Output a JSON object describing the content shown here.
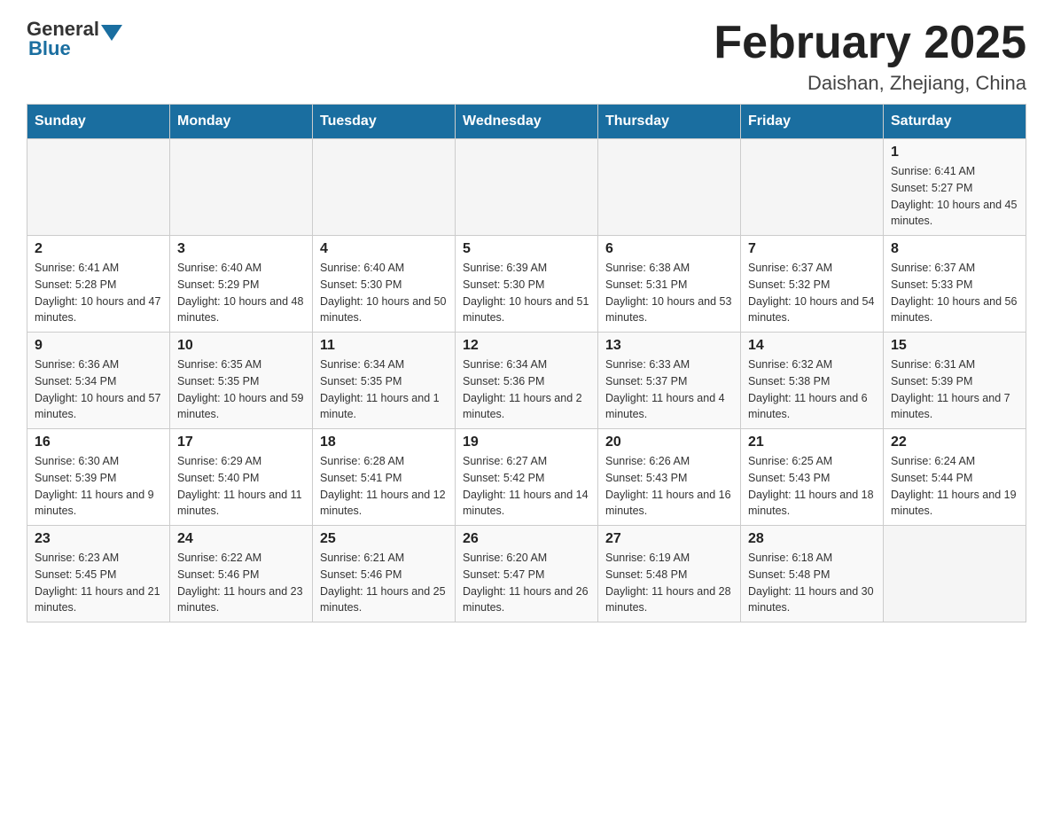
{
  "header": {
    "logo_general": "General",
    "logo_blue": "Blue",
    "month_title": "February 2025",
    "location": "Daishan, Zhejiang, China"
  },
  "weekdays": [
    "Sunday",
    "Monday",
    "Tuesday",
    "Wednesday",
    "Thursday",
    "Friday",
    "Saturday"
  ],
  "weeks": [
    [
      {
        "day": "",
        "sunrise": "",
        "sunset": "",
        "daylight": ""
      },
      {
        "day": "",
        "sunrise": "",
        "sunset": "",
        "daylight": ""
      },
      {
        "day": "",
        "sunrise": "",
        "sunset": "",
        "daylight": ""
      },
      {
        "day": "",
        "sunrise": "",
        "sunset": "",
        "daylight": ""
      },
      {
        "day": "",
        "sunrise": "",
        "sunset": "",
        "daylight": ""
      },
      {
        "day": "",
        "sunrise": "",
        "sunset": "",
        "daylight": ""
      },
      {
        "day": "1",
        "sunrise": "Sunrise: 6:41 AM",
        "sunset": "Sunset: 5:27 PM",
        "daylight": "Daylight: 10 hours and 45 minutes."
      }
    ],
    [
      {
        "day": "2",
        "sunrise": "Sunrise: 6:41 AM",
        "sunset": "Sunset: 5:28 PM",
        "daylight": "Daylight: 10 hours and 47 minutes."
      },
      {
        "day": "3",
        "sunrise": "Sunrise: 6:40 AM",
        "sunset": "Sunset: 5:29 PM",
        "daylight": "Daylight: 10 hours and 48 minutes."
      },
      {
        "day": "4",
        "sunrise": "Sunrise: 6:40 AM",
        "sunset": "Sunset: 5:30 PM",
        "daylight": "Daylight: 10 hours and 50 minutes."
      },
      {
        "day": "5",
        "sunrise": "Sunrise: 6:39 AM",
        "sunset": "Sunset: 5:30 PM",
        "daylight": "Daylight: 10 hours and 51 minutes."
      },
      {
        "day": "6",
        "sunrise": "Sunrise: 6:38 AM",
        "sunset": "Sunset: 5:31 PM",
        "daylight": "Daylight: 10 hours and 53 minutes."
      },
      {
        "day": "7",
        "sunrise": "Sunrise: 6:37 AM",
        "sunset": "Sunset: 5:32 PM",
        "daylight": "Daylight: 10 hours and 54 minutes."
      },
      {
        "day": "8",
        "sunrise": "Sunrise: 6:37 AM",
        "sunset": "Sunset: 5:33 PM",
        "daylight": "Daylight: 10 hours and 56 minutes."
      }
    ],
    [
      {
        "day": "9",
        "sunrise": "Sunrise: 6:36 AM",
        "sunset": "Sunset: 5:34 PM",
        "daylight": "Daylight: 10 hours and 57 minutes."
      },
      {
        "day": "10",
        "sunrise": "Sunrise: 6:35 AM",
        "sunset": "Sunset: 5:35 PM",
        "daylight": "Daylight: 10 hours and 59 minutes."
      },
      {
        "day": "11",
        "sunrise": "Sunrise: 6:34 AM",
        "sunset": "Sunset: 5:35 PM",
        "daylight": "Daylight: 11 hours and 1 minute."
      },
      {
        "day": "12",
        "sunrise": "Sunrise: 6:34 AM",
        "sunset": "Sunset: 5:36 PM",
        "daylight": "Daylight: 11 hours and 2 minutes."
      },
      {
        "day": "13",
        "sunrise": "Sunrise: 6:33 AM",
        "sunset": "Sunset: 5:37 PM",
        "daylight": "Daylight: 11 hours and 4 minutes."
      },
      {
        "day": "14",
        "sunrise": "Sunrise: 6:32 AM",
        "sunset": "Sunset: 5:38 PM",
        "daylight": "Daylight: 11 hours and 6 minutes."
      },
      {
        "day": "15",
        "sunrise": "Sunrise: 6:31 AM",
        "sunset": "Sunset: 5:39 PM",
        "daylight": "Daylight: 11 hours and 7 minutes."
      }
    ],
    [
      {
        "day": "16",
        "sunrise": "Sunrise: 6:30 AM",
        "sunset": "Sunset: 5:39 PM",
        "daylight": "Daylight: 11 hours and 9 minutes."
      },
      {
        "day": "17",
        "sunrise": "Sunrise: 6:29 AM",
        "sunset": "Sunset: 5:40 PM",
        "daylight": "Daylight: 11 hours and 11 minutes."
      },
      {
        "day": "18",
        "sunrise": "Sunrise: 6:28 AM",
        "sunset": "Sunset: 5:41 PM",
        "daylight": "Daylight: 11 hours and 12 minutes."
      },
      {
        "day": "19",
        "sunrise": "Sunrise: 6:27 AM",
        "sunset": "Sunset: 5:42 PM",
        "daylight": "Daylight: 11 hours and 14 minutes."
      },
      {
        "day": "20",
        "sunrise": "Sunrise: 6:26 AM",
        "sunset": "Sunset: 5:43 PM",
        "daylight": "Daylight: 11 hours and 16 minutes."
      },
      {
        "day": "21",
        "sunrise": "Sunrise: 6:25 AM",
        "sunset": "Sunset: 5:43 PM",
        "daylight": "Daylight: 11 hours and 18 minutes."
      },
      {
        "day": "22",
        "sunrise": "Sunrise: 6:24 AM",
        "sunset": "Sunset: 5:44 PM",
        "daylight": "Daylight: 11 hours and 19 minutes."
      }
    ],
    [
      {
        "day": "23",
        "sunrise": "Sunrise: 6:23 AM",
        "sunset": "Sunset: 5:45 PM",
        "daylight": "Daylight: 11 hours and 21 minutes."
      },
      {
        "day": "24",
        "sunrise": "Sunrise: 6:22 AM",
        "sunset": "Sunset: 5:46 PM",
        "daylight": "Daylight: 11 hours and 23 minutes."
      },
      {
        "day": "25",
        "sunrise": "Sunrise: 6:21 AM",
        "sunset": "Sunset: 5:46 PM",
        "daylight": "Daylight: 11 hours and 25 minutes."
      },
      {
        "day": "26",
        "sunrise": "Sunrise: 6:20 AM",
        "sunset": "Sunset: 5:47 PM",
        "daylight": "Daylight: 11 hours and 26 minutes."
      },
      {
        "day": "27",
        "sunrise": "Sunrise: 6:19 AM",
        "sunset": "Sunset: 5:48 PM",
        "daylight": "Daylight: 11 hours and 28 minutes."
      },
      {
        "day": "28",
        "sunrise": "Sunrise: 6:18 AM",
        "sunset": "Sunset: 5:48 PM",
        "daylight": "Daylight: 11 hours and 30 minutes."
      },
      {
        "day": "",
        "sunrise": "",
        "sunset": "",
        "daylight": ""
      }
    ]
  ]
}
